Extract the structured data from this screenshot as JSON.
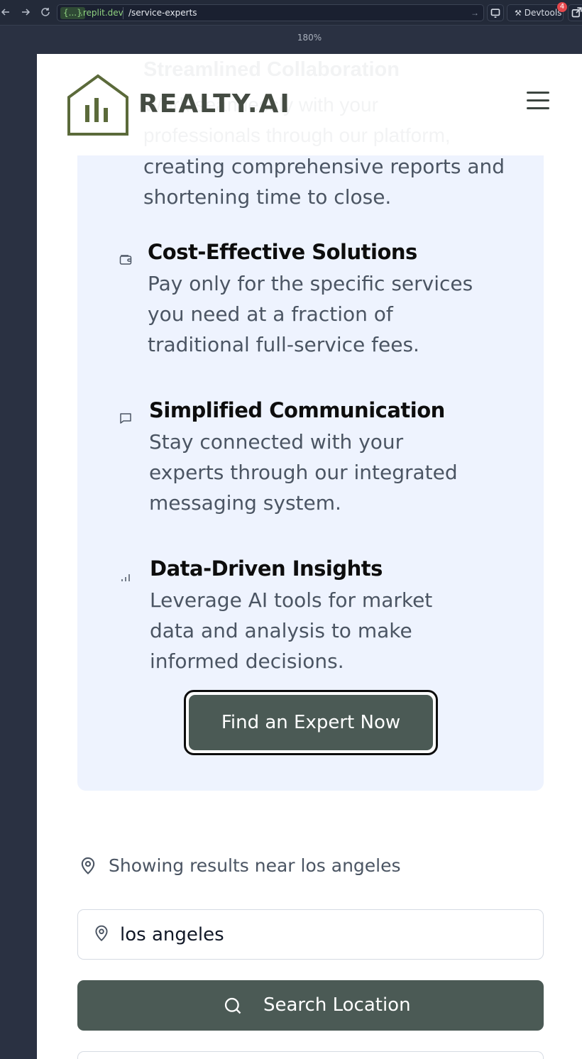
{
  "browser": {
    "url_badge": "{...}",
    "url_domain": ".replit.dev",
    "url_path": "/service-experts",
    "devtools_label": "Devtools",
    "devtools_count": "4",
    "zoom": "180%"
  },
  "header": {
    "brand": "REALTY.AI",
    "ghost_heading": "Streamlined Collaboration",
    "ghost_line_1": "Work seamlessly with your",
    "ghost_line_2": "professionals through our platform,"
  },
  "features": {
    "intro": "creating comprehensive reports and shortening time to close.",
    "items": [
      {
        "icon": "wallet-icon",
        "title": "Cost-Effective Solutions",
        "description": "Pay only for the specific services you need at a fraction of traditional full-service fees."
      },
      {
        "icon": "message-square-icon",
        "title": "Simplified Communication",
        "description": "Stay connected with your experts through our integrated messaging system."
      },
      {
        "icon": "bar-chart-icon",
        "title": "Data-Driven Insights",
        "description": "Leverage AI tools for market data and analysis to make informed decisions."
      }
    ],
    "cta_label": "Find an Expert Now"
  },
  "location": {
    "results_text": "Showing results near los angeles",
    "input_value": "los angeles",
    "search_label": "Search Location"
  },
  "colors": {
    "brand": "#444b42",
    "button": "#4b5a55",
    "card_bg": "#eef3fe"
  }
}
